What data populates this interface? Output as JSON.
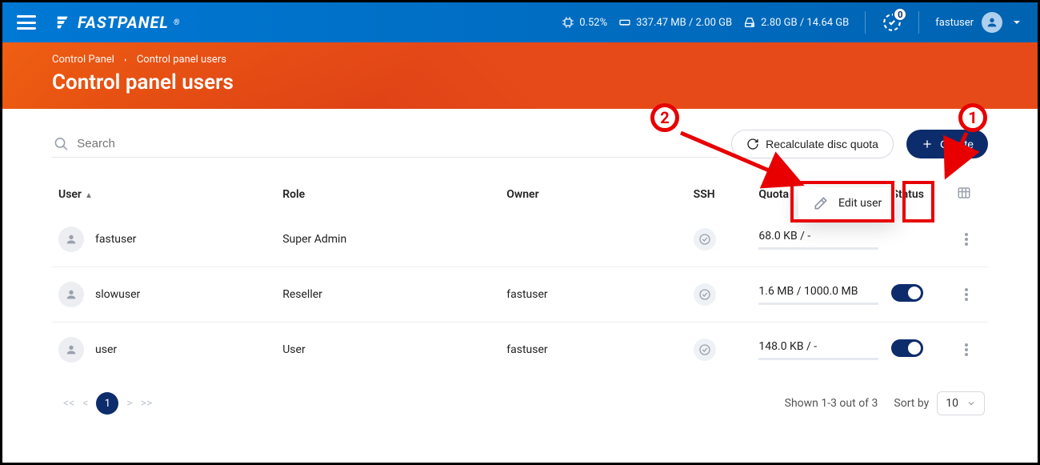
{
  "topbar": {
    "brand": "FASTPANEL",
    "brand_mark": "®",
    "cpu": "0.52%",
    "ram": "337.47 MB / 2.00 GB",
    "disk": "2.80 GB / 14.64 GB",
    "notif_count": "0",
    "username": "fastuser"
  },
  "hero": {
    "crumb_root": "Control Panel",
    "crumb_page": "Control panel users",
    "title": "Control panel users"
  },
  "toolbar": {
    "search_placeholder": "Search",
    "recalculate_label": "Recalculate disc quota",
    "create_label": "Create"
  },
  "columns": {
    "user": "User",
    "role": "Role",
    "owner": "Owner",
    "ssh": "SSH",
    "quota": "Quota",
    "status": "Status"
  },
  "rows": [
    {
      "user": "fastuser",
      "role": "Super Admin",
      "owner": "",
      "quota": "68.0 KB / -",
      "status_toggle": false
    },
    {
      "user": "slowuser",
      "role": "Reseller",
      "owner": "fastuser",
      "quota": "1.6 MB / 1000.0 MB",
      "status_toggle": true
    },
    {
      "user": "user",
      "role": "User",
      "owner": "fastuser",
      "quota": "148.0 KB / -",
      "status_toggle": true
    }
  ],
  "tooltip": {
    "edit_user": "Edit user"
  },
  "footer": {
    "page_current": "1",
    "shown_text": "Shown 1-3 out of 3",
    "sort_by_label": "Sort by",
    "page_size": "10"
  },
  "annotations": {
    "one": "1",
    "two": "2"
  }
}
